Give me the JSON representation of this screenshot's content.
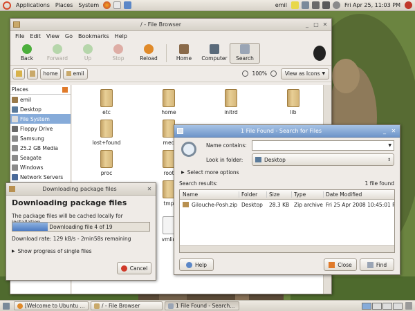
{
  "top_panel": {
    "menus": [
      "Applications",
      "Places",
      "System"
    ],
    "user": "emil",
    "datetime": "Fri Apr 25, 11:03 PM"
  },
  "file_browser": {
    "title": "/ - File Browser",
    "menus": [
      "File",
      "Edit",
      "View",
      "Go",
      "Bookmarks",
      "Help"
    ],
    "toolbar": [
      "Back",
      "Forward",
      "Up",
      "Stop",
      "Reload",
      "Home",
      "Computer",
      "Search"
    ],
    "path": [
      "home",
      "emil"
    ],
    "zoom": "100%",
    "view_mode": "View as Icons",
    "places_label": "Places",
    "places": [
      "emil",
      "Desktop",
      "File System",
      "Floppy Drive",
      "Samsung",
      "25.2 GB Media",
      "Seagate",
      "Windows",
      "Network Servers"
    ],
    "folders": [
      "etc",
      "home",
      "initrd",
      "lib",
      "lost+found",
      "med",
      "proc",
      "root",
      "tmp",
      "vmlin"
    ]
  },
  "search": {
    "title": "1 File Found - Search for Files",
    "name_label": "Name contains:",
    "name_value": "",
    "folder_label": "Look in folder:",
    "folder_value": "Desktop",
    "more_options": "Select more options",
    "results_label": "Search results:",
    "results_count": "1 file found",
    "columns": [
      "Name",
      "Folder",
      "Size",
      "Type",
      "Date Modified"
    ],
    "rows": [
      {
        "name": "Gilouche-Posh.zip",
        "folder": "Desktop",
        "size": "28.3 KB",
        "type": "Zip archive",
        "date": "Fri 25 Apr 2008 10:45:01 P"
      }
    ],
    "help": "Help",
    "close": "Close",
    "find": "Find"
  },
  "download": {
    "title": "Downloading package files",
    "heading": "Downloading package files",
    "info": "The package files will be cached locally for installation.",
    "progress_text": "Downloading file 4 of 19",
    "progress": 0.26,
    "rate": "Download rate: 129 kB/s - 2min58s remaining",
    "details": "Show progress of single files",
    "cancel": "Cancel"
  },
  "taskbar": [
    "[Welcome to Ubuntu ...",
    "/ - File Browser",
    "1 File Found - Search..."
  ]
}
